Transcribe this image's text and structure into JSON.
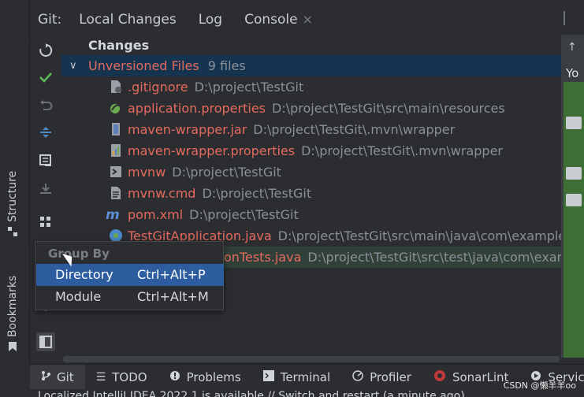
{
  "colors": {
    "accent": "#4a88c7",
    "selection": "#14344f",
    "unversioned": "#e56a5f",
    "popup_active": "#2e5d9f"
  },
  "left_tabs": [
    {
      "label": "Structure",
      "icon": "structure-icon"
    },
    {
      "label": "Bookmarks",
      "icon": "bookmark-icon"
    }
  ],
  "tabs": {
    "prefix": "Git:",
    "items": [
      {
        "label": "Local Changes"
      },
      {
        "label": "Log"
      },
      {
        "label": "Console"
      }
    ]
  },
  "toolbar": [
    {
      "icon": "refresh-icon"
    },
    {
      "icon": "commit-check-icon"
    },
    {
      "icon": "rollback-icon"
    },
    {
      "icon": "update-icon"
    },
    {
      "icon": "diff-icon"
    },
    {
      "icon": "shelve-icon"
    },
    {
      "icon": "group-by-icon"
    },
    {
      "icon": "expand-icon"
    },
    {
      "icon": "layout-icon"
    }
  ],
  "tree": {
    "header": "Changes",
    "group": {
      "label": "Unversioned Files",
      "count": "9 files"
    },
    "files": [
      {
        "name": ".gitignore",
        "path": "D:\\project\\TestGit",
        "icon": "gitignore-icon"
      },
      {
        "name": "application.properties",
        "path": "D:\\project\\TestGit\\src\\main\\resources",
        "icon": "spring-properties-icon"
      },
      {
        "name": "maven-wrapper.jar",
        "path": "D:\\project\\TestGit\\.mvn\\wrapper",
        "icon": "jar-icon"
      },
      {
        "name": "maven-wrapper.properties",
        "path": "D:\\project\\TestGit\\.mvn\\wrapper",
        "icon": "properties-icon"
      },
      {
        "name": "mvnw",
        "path": "D:\\project\\TestGit",
        "icon": "shell-icon"
      },
      {
        "name": "mvnw.cmd",
        "path": "D:\\project\\TestGit",
        "icon": "text-file-icon"
      },
      {
        "name": "pom.xml",
        "path": "D:\\project\\TestGit",
        "icon": "maven-icon"
      },
      {
        "name": "TestGitApplication.java",
        "path": "D:\\project\\TestGit\\src\\main\\java\\com\\example\\",
        "icon": "java-class-icon"
      },
      {
        "name": "onTests.java",
        "path": "D:\\project\\TestGit\\src\\test\\java\\com\\exam",
        "icon": "java-class-icon"
      }
    ]
  },
  "popup": {
    "title": "Group By",
    "items": [
      {
        "label": "Directory",
        "shortcut": "Ctrl+Alt+P"
      },
      {
        "label": "Module",
        "shortcut": "Ctrl+Alt+M"
      }
    ]
  },
  "right_panel": {
    "text": "Yo"
  },
  "bottom_tabs": [
    {
      "label": "Git",
      "icon": "git-branch-icon"
    },
    {
      "label": "TODO",
      "icon": "todo-icon"
    },
    {
      "label": "Problems",
      "icon": "problems-icon"
    },
    {
      "label": "Terminal",
      "icon": "terminal-icon"
    },
    {
      "label": "Profiler",
      "icon": "profiler-icon"
    },
    {
      "label": "SonarLint",
      "icon": "sonarlint-icon"
    },
    {
      "label": "Services",
      "icon": "services-icon"
    }
  ],
  "status_bar": {
    "text": "Localized IntelliJ IDEA 2022.1 is available // Switch and restart (a minute ago)"
  },
  "watermark": "CSDN @懒羊羊oo"
}
